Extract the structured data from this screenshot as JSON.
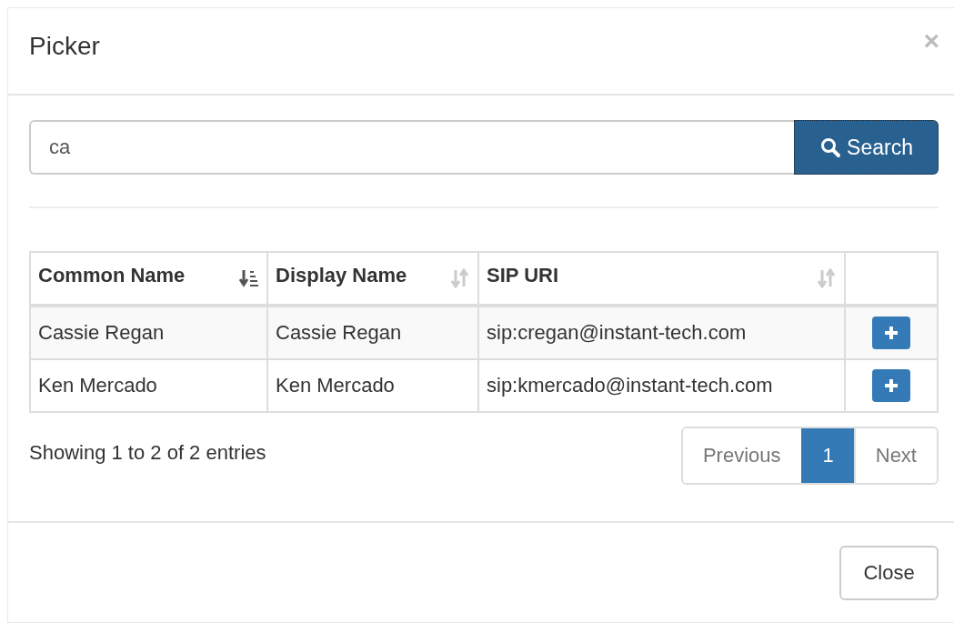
{
  "dialog": {
    "title": "Picker",
    "close_glyph": "×"
  },
  "search": {
    "value": "ca",
    "button": "Search"
  },
  "table": {
    "columns": [
      {
        "label": "Common Name",
        "kind": "sorted"
      },
      {
        "label": "Display Name",
        "kind": "sortable"
      },
      {
        "label": "SIP URI",
        "kind": "sortable"
      },
      {
        "kind": "plain"
      }
    ],
    "rows": [
      {
        "cells": [
          "Cassie Regan",
          "Cassie Regan",
          "sip:cregan@instant-tech.com"
        ]
      },
      {
        "cells": [
          "Ken Mercado",
          "Ken Mercado",
          "sip:kmercado@instant-tech.com"
        ]
      }
    ]
  },
  "info": "Showing 1 to 2 of 2 entries",
  "pagination": [
    {
      "label": "Previous",
      "selected": false,
      "disabled": true
    },
    {
      "label": "1",
      "selected": true,
      "disabled": false
    },
    {
      "label": "Next",
      "selected": false,
      "disabled": true
    }
  ],
  "footer": {
    "button": "Close"
  }
}
